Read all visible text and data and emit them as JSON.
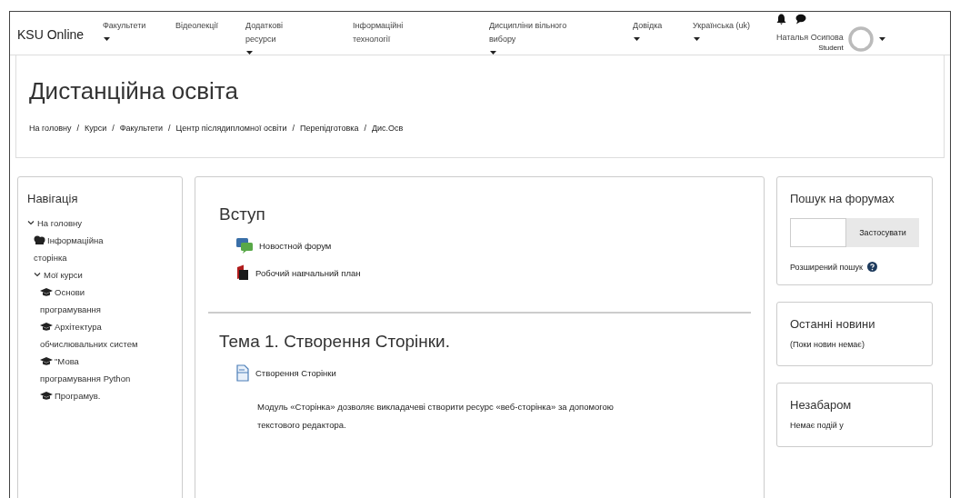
{
  "navbar": {
    "brand": "KSU Online",
    "items": [
      {
        "label": "Факультети",
        "has_menu": true
      },
      {
        "label": "Відеолекції",
        "has_menu": false
      },
      {
        "label": "Додаткові ресурси",
        "has_menu": true
      },
      {
        "label": "Інформаційні технології",
        "has_menu": false
      },
      {
        "label": "Дисципліни вільного вибору",
        "has_menu": true
      },
      {
        "label": "Довідка",
        "has_menu": true
      },
      {
        "label": "Українська (uk)",
        "has_menu": true
      }
    ],
    "user": {
      "name": "Наталья Осипова",
      "role": "Student"
    }
  },
  "header": {
    "title": "Дистанційна освіта",
    "separator": "/",
    "breadcrumb": [
      "На головну",
      "Курси",
      "Факультети",
      "Центр післядипломної освіти",
      "Перепідготовка",
      "Дис.Осв"
    ]
  },
  "navigation": {
    "title": "Навігація",
    "tree": [
      {
        "label": "На головну",
        "expanded": true,
        "children": [
          {
            "label": "Інформаційна сторінка",
            "kind": "site"
          },
          {
            "label": "Мої курси",
            "expanded": true,
            "children": [
              {
                "label": "Основи програмування",
                "kind": "course"
              },
              {
                "label": "Архітектура обчислювальних систем",
                "kind": "course"
              },
              {
                "label": "\"Мова програмування Python",
                "kind": "course"
              },
              {
                "label": "Програмув.",
                "kind": "course"
              }
            ]
          }
        ]
      }
    ]
  },
  "sections": [
    {
      "title": "Вступ",
      "activities": [
        {
          "kind": "forum",
          "label": "Новостной форум"
        },
        {
          "kind": "pdf",
          "label": "Робочий навчальний план"
        }
      ]
    },
    {
      "title": "Тема 1. Створення Сторінки.",
      "activities": [
        {
          "kind": "page",
          "label": "Створення Сторінки",
          "description": "Модуль «Сторінка» дозволяє викладачеві створити ресурс «веб-сторінка» за допомогою текстового редактора."
        }
      ]
    }
  ],
  "blocks": [
    {
      "kind": "search",
      "title": "Пошук на форумах",
      "button": "Застосувати",
      "link": "Розширений пошук"
    },
    {
      "kind": "text",
      "title": "Останні новини",
      "text": "(Поки новин немає)"
    },
    {
      "kind": "text",
      "title": "Незабаром",
      "text": "Немає подій у"
    }
  ]
}
